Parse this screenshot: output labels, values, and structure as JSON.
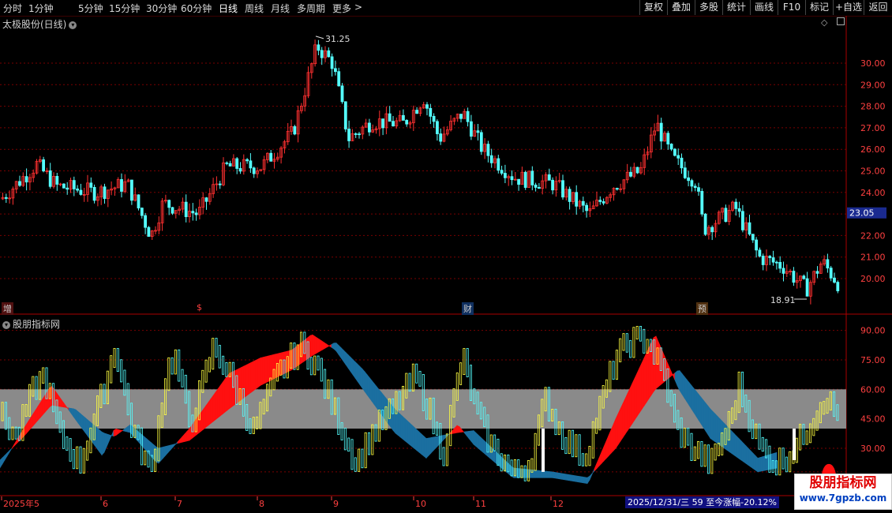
{
  "toolbar": {
    "periods": [
      "分时",
      "1分钟",
      "5分钟",
      "15分钟",
      "30分钟",
      "60分钟",
      "日线",
      "周线",
      "月线",
      "多周期",
      "更多"
    ],
    "active_period": "日线",
    "more_arrow": ">",
    "buttons": [
      "复权",
      "叠加",
      "多股",
      "统计",
      "画线",
      "F10",
      "标记",
      "+自选",
      "返回"
    ]
  },
  "main_panel": {
    "title": "太极股份(日线)",
    "high_label": "31.25",
    "low_label": "18.91",
    "current_price": "23.05",
    "price_axis": [
      "30.00",
      "29.00",
      "28.00",
      "27.00",
      "26.00",
      "25.00",
      "24.00",
      "23.00",
      "22.00",
      "21.00",
      "20.00"
    ],
    "markers": [
      {
        "text": "增",
        "color": "#ff4040"
      },
      {
        "text": "$",
        "color": "#ff4040"
      },
      {
        "text": "财",
        "color": "#4aa8ff"
      },
      {
        "text": "预",
        "color": "#ff8040"
      }
    ]
  },
  "indicator_panel": {
    "title": "股朋指标网",
    "axis": [
      "90.00",
      "75.00",
      "60.00",
      "45.00",
      "30.00"
    ]
  },
  "x_axis": [
    "2025年5",
    "6",
    "7",
    "8",
    "9",
    "10",
    "11",
    "12"
  ],
  "status_text": "2025/12/31/三  59 至今涨幅-20.12%",
  "watermark": {
    "line1": "股朋指标网",
    "line2": "www.7gpzb.com"
  },
  "colors": {
    "up": "#ff3030",
    "down": "#54ffff",
    "grid": "#7a0000",
    "band": "#8a8a8a",
    "blue": "#1b6fa0",
    "yellow": "#ffff40"
  }
}
